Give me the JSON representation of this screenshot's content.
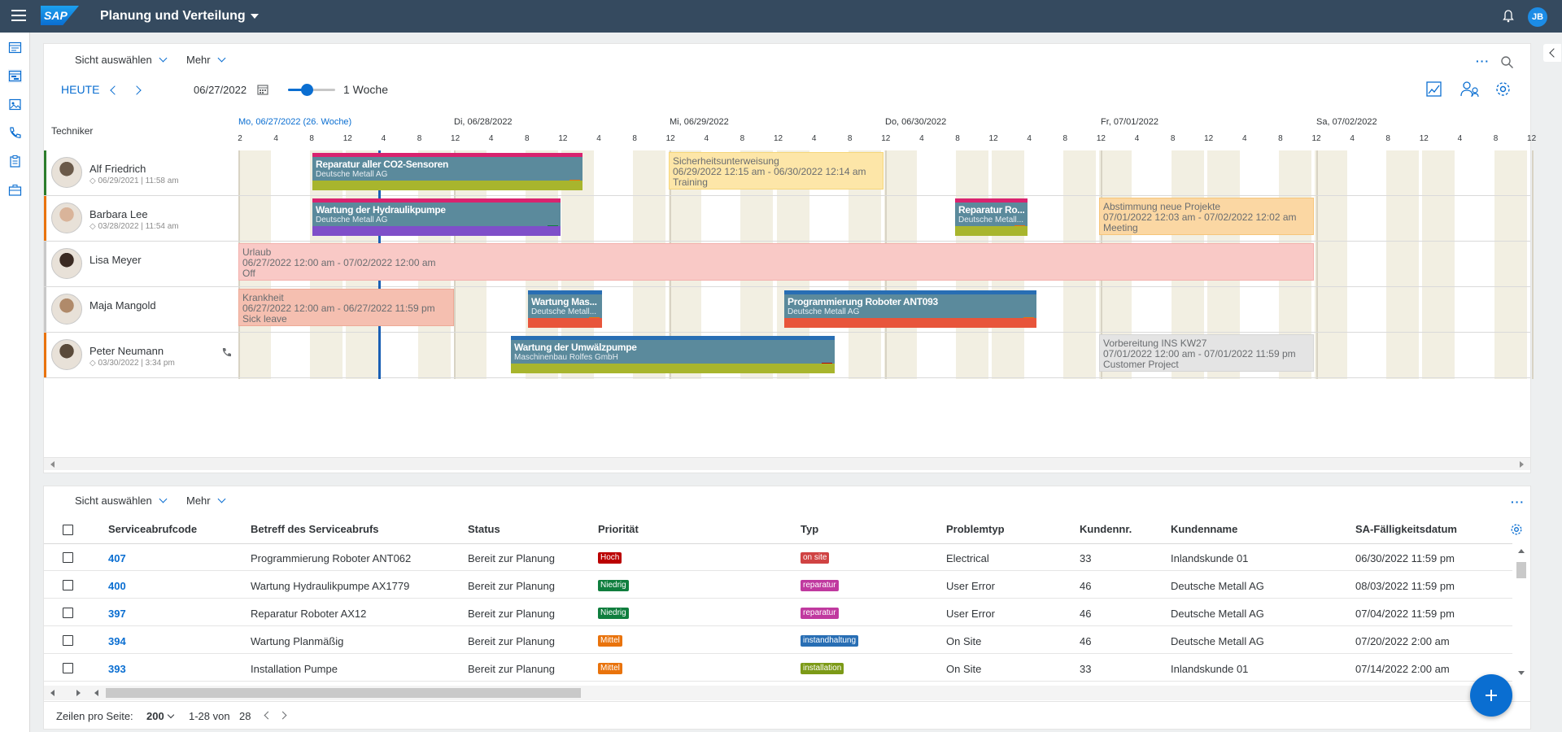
{
  "shell": {
    "logo": "SAP",
    "title": "Planung und Verteilung",
    "user_initials": "JB"
  },
  "colors": {
    "shell_bg": "#354a5f",
    "accent": "#0a6ed1",
    "today_line": "#1a5fb4"
  },
  "planning": {
    "view_select": "Sicht auswählen",
    "more": "Mehr",
    "today": "HEUTE",
    "date_value": "06/27/2022",
    "zoom_label": "1 Woche",
    "zoom_level": 0.4,
    "technician_header": "Techniker",
    "days": [
      "Mo, 06/27/2022 (26. Woche)",
      "Di, 06/28/2022",
      "Mi, 06/29/2022",
      "Do, 06/30/2022",
      "Fr, 07/01/2022",
      "Sa, 07/02/2022"
    ],
    "hours": [
      "2",
      "4",
      "8",
      "12",
      "4",
      "8",
      "12",
      "4",
      "8",
      "12",
      "4",
      "8",
      "12",
      "4",
      "8",
      "12",
      "4",
      "8",
      "12",
      "4",
      "8",
      "12",
      "4",
      "8",
      "12",
      "4",
      "8",
      "12",
      "4",
      "8",
      "12",
      "4",
      "8",
      "12",
      "4",
      "8",
      "12",
      "4",
      "8"
    ],
    "technicians": [
      {
        "name": "Alf Friedrich",
        "sub": "06/29/2021 | 11:58 am",
        "color": "#2b7d2b"
      },
      {
        "name": "Barbara Lee",
        "sub": "03/28/2022 | 11:54 am",
        "color": "#e9730c"
      },
      {
        "name": "Lisa Meyer",
        "sub": "",
        "color": "#c8c8c8"
      },
      {
        "name": "Maja Mangold",
        "sub": "",
        "color": "#c8c8c8"
      },
      {
        "name": "Peter Neumann",
        "sub": "03/30/2022 | 3:34 pm",
        "color": "#e9730c"
      }
    ],
    "assignments": [
      {
        "title": "Reparatur aller CO2-Sensoren",
        "customer": "Deutsche Metall AG",
        "priority": "M"
      },
      {
        "title": "Wartung der Hydraulikpumpe",
        "customer": "Deutsche Metall AG",
        "priority": "N"
      },
      {
        "title": "Reparatur Ro...",
        "customer": "Deutsche Metall...",
        "priority": "M"
      },
      {
        "title": "Wartung Mas...",
        "customer": "Deutsche Metall...",
        "priority": "M"
      },
      {
        "title": "Programmierung Roboter ANT093",
        "customer": "Deutsche Metall AG",
        "priority": "M"
      },
      {
        "title": "Wartung der Umwälzpumpe",
        "customer": "Maschinenbau Rolfes GmbH",
        "priority": "H"
      }
    ],
    "absences": [
      {
        "title": "Sicherheitsunterweisung",
        "range": "06/29/2022 12:15 am - 06/30/2022 12:14 am",
        "type": "Training"
      },
      {
        "title": "Abstimmung neue Projekte",
        "range": "07/01/2022 12:03 am - 07/02/2022 12:02 am",
        "type": "Meeting"
      },
      {
        "title": "Urlaub",
        "range": "06/27/2022 12:00 am - 07/02/2022 12:00 am",
        "type": "Off"
      },
      {
        "title": "Krankheit",
        "range": "06/27/2022 12:00 am - 06/27/2022 11:59 pm",
        "type": "Sick leave"
      },
      {
        "title": "Vorbereitung INS KW27",
        "range": "07/01/2022 12:00 am - 07/01/2022 11:59 pm",
        "type": "Customer Project"
      }
    ]
  },
  "table": {
    "view_select": "Sicht auswählen",
    "more": "Mehr",
    "columns": [
      "Serviceabrufcode",
      "Betreff des Serviceabrufs",
      "Status",
      "Priorität",
      "Typ",
      "Problemtyp",
      "Kundennr.",
      "Kundenname",
      "SA-Fälligkeitsdatum"
    ],
    "rows": [
      {
        "code": "407",
        "subject": "Programmierung Roboter ANT062",
        "status": "Bereit zur Planung",
        "priority": "Hoch",
        "priority_color": "#bb0000",
        "type": "on site",
        "type_color": "#d04343",
        "problem": "Electrical",
        "custno": "33",
        "custname": "Inlandskunde 01",
        "due": "06/30/2022 11:59 pm"
      },
      {
        "code": "400",
        "subject": "Wartung Hydraulikpumpe AX1779",
        "status": "Bereit zur Planung",
        "priority": "Niedrig",
        "priority_color": "#107e3e",
        "type": "reparatur",
        "type_color": "#c0399f",
        "problem": "User Error",
        "custno": "46",
        "custname": "Deutsche Metall AG",
        "due": "08/03/2022 11:59 pm"
      },
      {
        "code": "397",
        "subject": "Reparatur Roboter AX12",
        "status": "Bereit zur Planung",
        "priority": "Niedrig",
        "priority_color": "#107e3e",
        "type": "reparatur",
        "type_color": "#c0399f",
        "problem": "User Error",
        "custno": "46",
        "custname": "Deutsche Metall AG",
        "due": "07/04/2022 11:59 pm"
      },
      {
        "code": "394",
        "subject": "Wartung Planmäßig",
        "status": "Bereit zur Planung",
        "priority": "Mittel",
        "priority_color": "#e9730c",
        "type": "instandhaltung",
        "type_color": "#286eb4",
        "problem": "On Site",
        "custno": "46",
        "custname": "Deutsche Metall AG",
        "due": "07/20/2022 2:00 am"
      },
      {
        "code": "393",
        "subject": "Installation Pumpe",
        "status": "Bereit zur Planung",
        "priority": "Mittel",
        "priority_color": "#e9730c",
        "type": "installation",
        "type_color": "#7c9a17",
        "problem": "On Site",
        "custno": "33",
        "custname": "Inlandskunde 01",
        "due": "07/14/2022 2:00 am"
      }
    ],
    "footer": {
      "rows_label": "Zeilen pro Seite:",
      "rows_value": "200",
      "range": "1-28 von",
      "total": "28"
    }
  }
}
